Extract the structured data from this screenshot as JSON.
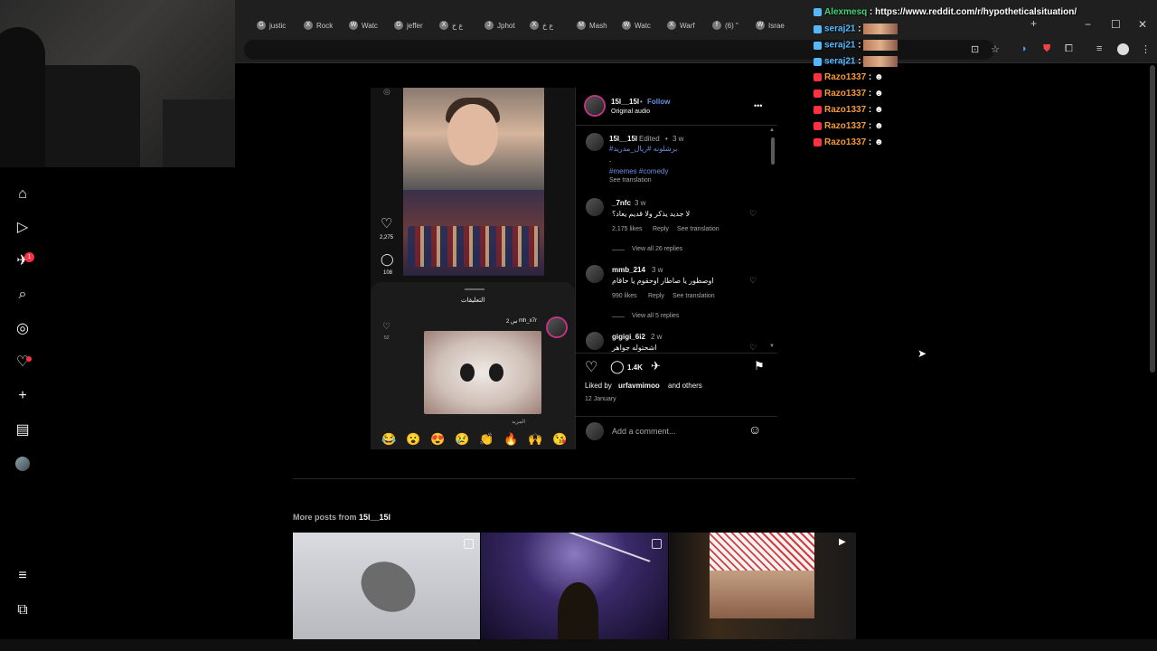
{
  "browser": {
    "tabs": [
      {
        "label": "justic",
        "icon": "G"
      },
      {
        "label": "Rock",
        "icon": "X"
      },
      {
        "label": "Watc",
        "icon": "W"
      },
      {
        "label": "jeffer",
        "icon": "G"
      },
      {
        "label": "ع خ",
        "icon": "X"
      },
      {
        "label": "Jphot",
        "icon": "J"
      },
      {
        "label": "ع خ",
        "icon": "X"
      },
      {
        "label": "Mash",
        "icon": "M"
      },
      {
        "label": "Watc",
        "icon": "W"
      },
      {
        "label": "Warf",
        "icon": "X"
      },
      {
        "label": "(6) \"",
        "icon": "f"
      },
      {
        "label": "Israe",
        "icon": "W"
      }
    ],
    "new_tab": "+",
    "win_min": "−",
    "win_max": "☐",
    "win_close": "✕"
  },
  "sidebar": {
    "items": [
      {
        "name": "home-icon",
        "glyph": "⌂"
      },
      {
        "name": "reels-icon",
        "glyph": "▷"
      },
      {
        "name": "messages-icon",
        "glyph": "✈"
      },
      {
        "name": "search-icon",
        "glyph": "⌕"
      },
      {
        "name": "explore-icon",
        "glyph": "◎"
      },
      {
        "name": "notifications-icon",
        "glyph": "♡"
      },
      {
        "name": "create-icon",
        "glyph": "+"
      },
      {
        "name": "dashboard-icon",
        "glyph": "▤"
      },
      {
        "name": "profile-avatar",
        "glyph": "●"
      }
    ],
    "messages_badge": "1",
    "more_icon": "≡",
    "also_from_meta_icon": "⧉"
  },
  "post": {
    "media": {
      "like_count": "2,275",
      "comment_count": "108",
      "sheet_title": "التعليقات",
      "comment_user": "mh_x7r",
      "comment_time": "2 س",
      "comment_likes": "52",
      "comment_more": "المزيد",
      "emojis": [
        "😂",
        "😮",
        "😍",
        "😢",
        "👏",
        "🔥",
        "🙌",
        "😘"
      ]
    },
    "header": {
      "username": "15l__15l",
      "follow": "Follow",
      "subtitle": "Original audio",
      "more": "•••"
    },
    "caption": {
      "username": "15l__15l",
      "edited": "Edited",
      "time": "3 w",
      "hashtags_ar": "#برشلونه #ريال_مدريد",
      "dot": ".",
      "hashtags_en": "#memes #comedy",
      "see_translation": "See translation"
    },
    "comments": [
      {
        "user": "_7nfc",
        "time": "3 w",
        "text": "لا جديد يذكر ولا قديم يعاد؟",
        "likes": "2,175 likes",
        "reply": "Reply",
        "translate": "See translation",
        "view_replies": "View all 26 replies"
      },
      {
        "user": "mmb_214",
        "time": "3 w",
        "text": "اوصطور يا صاطار اوحقوم يا حاقام",
        "likes": "990 likes",
        "reply": "Reply",
        "translate": "See translation",
        "view_replies": "View all 5 replies"
      },
      {
        "user": "gigigi_6i2",
        "time": "2 w",
        "text": "اشحتوله جواهر"
      }
    ],
    "actions": {
      "comment_count": "1.4K",
      "liked_by_prefix": "Liked by",
      "liked_by_user": "urfavmimoo",
      "liked_by_suffix": "and others",
      "date": "12 January"
    },
    "add_comment_placeholder": "Add a comment..."
  },
  "more_posts": {
    "prefix": "More posts from",
    "username": "15l__15l"
  },
  "chat": [
    {
      "name": "Alexmesq",
      "msg": "https://www.reddit.com/r/hypotheticalsituation/",
      "platform": "kick",
      "emote": false
    },
    {
      "name": "seraj21",
      "msg": "",
      "platform": "kick",
      "emote": true
    },
    {
      "name": "seraj21",
      "msg": "",
      "platform": "kick",
      "emote": true
    },
    {
      "name": "seraj21",
      "msg": "",
      "platform": "kick",
      "emote": true
    },
    {
      "name": "Razo1337",
      "msg": "",
      "platform": "youtube",
      "emote": false
    },
    {
      "name": "Razo1337",
      "msg": "",
      "platform": "youtube",
      "emote": false
    },
    {
      "name": "Razo1337",
      "msg": "",
      "platform": "youtube",
      "emote": false
    },
    {
      "name": "Razo1337",
      "msg": "",
      "platform": "youtube",
      "emote": false
    },
    {
      "name": "Razo1337",
      "msg": "",
      "platform": "youtube",
      "emote": false
    }
  ],
  "colors": {
    "instagram_link": "#6a8fe0",
    "notification_red": "#ff3040",
    "chat_green": "#43d17a",
    "chat_blue": "#55b8ff",
    "chat_orange": "#f39a3a"
  }
}
